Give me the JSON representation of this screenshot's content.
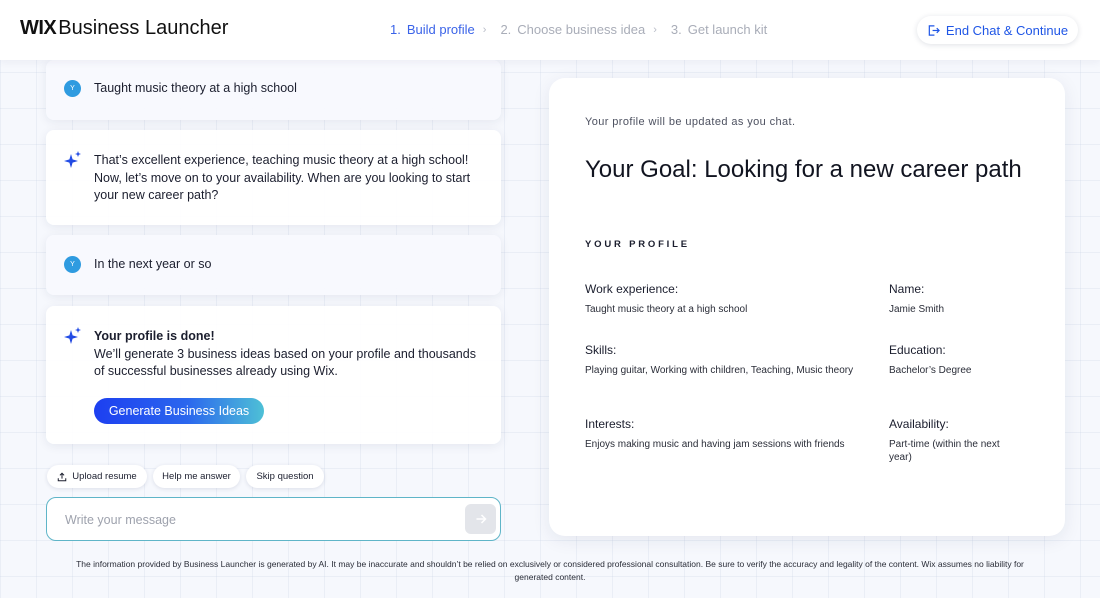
{
  "header": {
    "logo_mark": "WIX",
    "logo_text": "Business Launcher",
    "steps": [
      {
        "num": "1.",
        "label": "Build profile"
      },
      {
        "num": "2.",
        "label": "Choose business idea"
      },
      {
        "num": "3.",
        "label": "Get launch kit"
      }
    ],
    "end_chat_label": "End Chat & Continue"
  },
  "chat": {
    "messages": [
      {
        "author_initial": "Y",
        "text": "Taught music theory at a high school"
      },
      {
        "text": "That’s excellent experience, teaching music theory at a high school! Now, let’s move on to your availability. When are you looking to start your new career path?"
      },
      {
        "author_initial": "Y",
        "text": "In the next year or so"
      },
      {
        "title": "Your profile is done!",
        "text": "We’ll generate 3 business ideas based on your profile and thousands of successful businesses already using Wix.",
        "button": "Generate Business Ideas"
      }
    ],
    "chips": [
      "Upload resume",
      "Help me answer",
      "Skip question"
    ],
    "input_placeholder": "Write your message"
  },
  "profile": {
    "note": "Your profile will be updated as you chat.",
    "goal": "Your Goal: Looking for a new career path",
    "section_title": "YOUR PROFILE",
    "fields": {
      "work": {
        "label": "Work experience:",
        "value": "Taught music theory at a high school"
      },
      "name": {
        "label": "Name:",
        "value": "Jamie Smith"
      },
      "skills": {
        "label": "Skills:",
        "value": "Playing guitar, Working with children, Teaching, Music theory"
      },
      "education": {
        "label": "Education:",
        "value": "Bachelor’s Degree"
      },
      "interests": {
        "label": "Interests:",
        "value": "Enjoys making music and having jam sessions with friends"
      },
      "availability": {
        "label": "Availability:",
        "value": "Part-time (within the next year)"
      }
    }
  },
  "disclaimer": "The information provided by Business Launcher is generated by AI. It may be inaccurate and shouldn’t be relied on exclusively or considered professional consultation. Be sure to verify the accuracy and legality of the content. Wix assumes no liability for generated content.",
  "colors": {
    "accent": "#1f56e6",
    "active_step": "#3a63e8",
    "avatar": "#2f9be0",
    "input_border": "#5fb5c8"
  }
}
